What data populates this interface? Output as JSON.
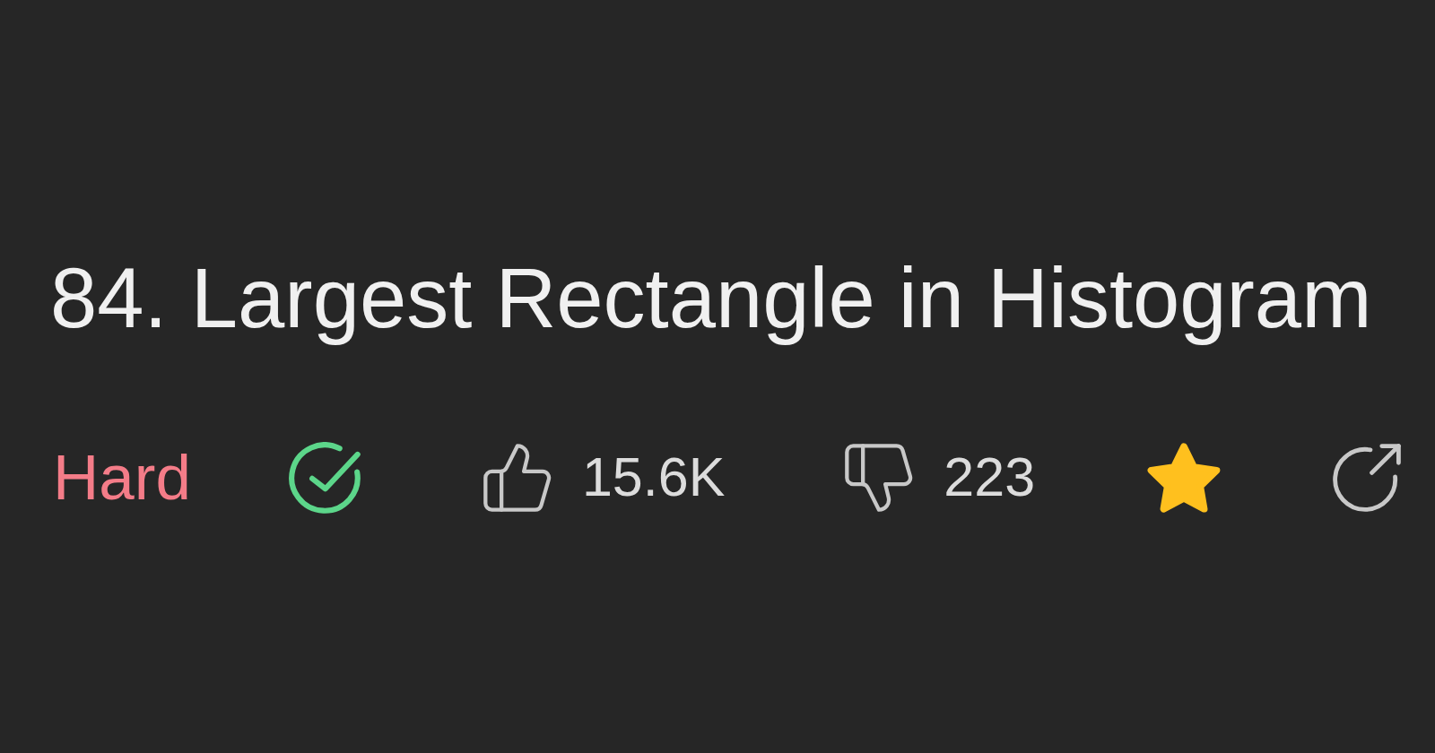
{
  "title": "84. Largest Rectangle in Histogram",
  "stats": {
    "difficulty": {
      "label": "Hard",
      "kind": "hard"
    },
    "solved": true,
    "likes": {
      "count": "15.6K"
    },
    "dislikes": {
      "count": "223"
    },
    "favorite": {
      "selected": true
    }
  }
}
